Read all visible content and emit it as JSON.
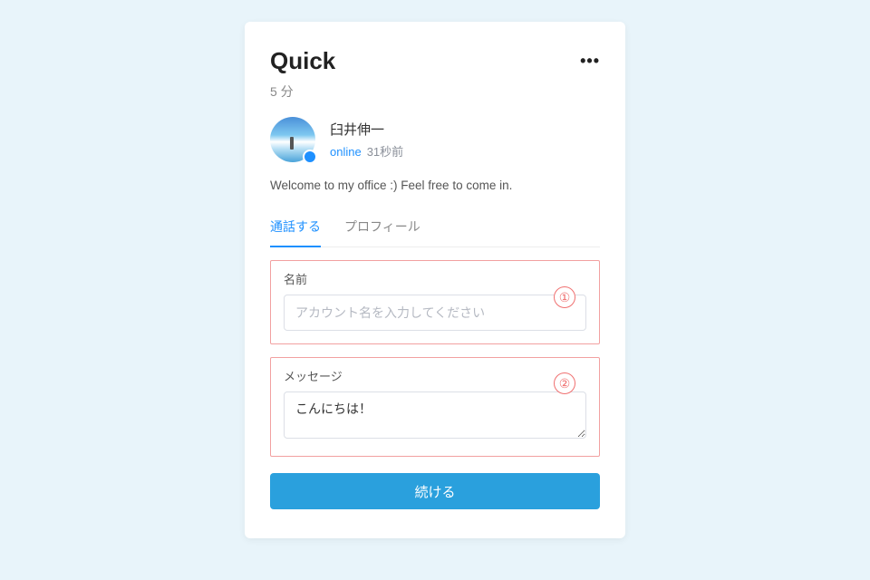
{
  "header": {
    "title": "Quick",
    "subtitle": "5 分",
    "more_icon": "more-horizontal-icon"
  },
  "user": {
    "name": "臼井伸一",
    "status_label": "online",
    "time_ago": "31秒前",
    "status_color": "#1e90ff"
  },
  "welcome_message": "Welcome to my office :) Feel free to come in.",
  "tabs": {
    "call": "通話する",
    "profile": "プロフィール",
    "active": "call"
  },
  "form": {
    "name": {
      "label": "名前",
      "placeholder": "アカウント名を入力してください",
      "value": "",
      "callout": "①"
    },
    "message": {
      "label": "メッセージ",
      "value": "こんにちは！",
      "callout": "②"
    },
    "submit_label": "続ける"
  },
  "colors": {
    "accent": "#1e90ff",
    "button": "#2aa0dd",
    "callout_border": "#f2a0a0"
  }
}
